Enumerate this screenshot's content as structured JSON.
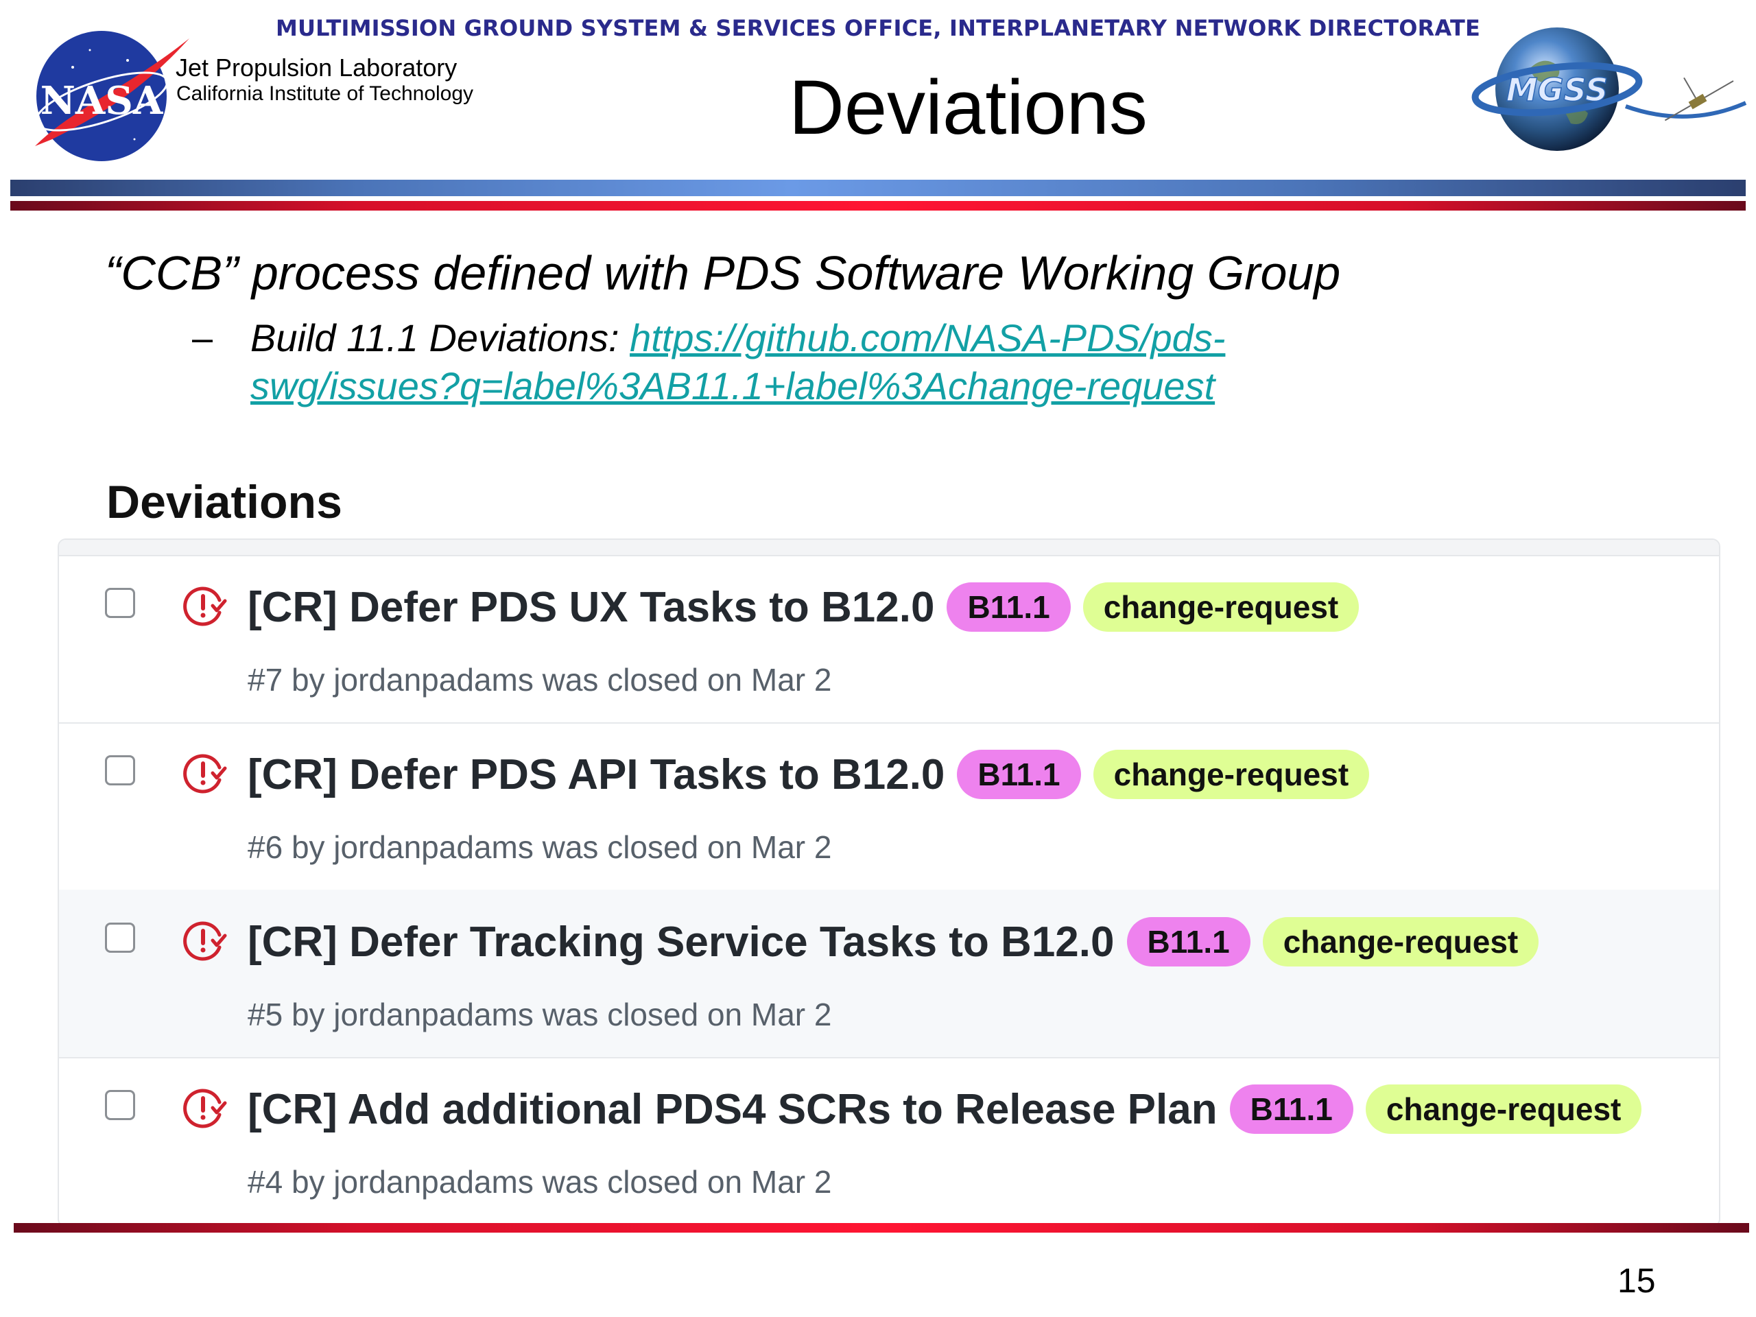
{
  "header": {
    "directorate": "MULTIMISSION GROUND SYSTEM & SERVICES OFFICE, INTERPLANETARY NETWORK DIRECTORATE",
    "jpl_line1": "Jet Propulsion Laboratory",
    "jpl_line2": "California Institute of Technology",
    "title": "Deviations",
    "nasa_logo_text": "NASA",
    "mgss_logo_text": "MGSS"
  },
  "body": {
    "ccb_line": "“CCB” process defined with PDS Software Working Group",
    "bullet_dash": "–",
    "build_label": "Build 11.1 Deviations: ",
    "build_url": "https://github.com/NASA-PDS/pds-swg/issues?q=label%3AB11.1+label%3Achange-request"
  },
  "panel": {
    "heading": "Deviations",
    "issues": [
      {
        "title": "[CR] Defer PDS UX Tasks to B12.0",
        "label1": "B11.1",
        "label2": "change-request",
        "meta": "#7 by jordanpadams was closed on Mar 2"
      },
      {
        "title": "[CR] Defer PDS API Tasks to B12.0",
        "label1": "B11.1",
        "label2": "change-request",
        "meta": "#6 by jordanpadams was closed on Mar 2"
      },
      {
        "title": "[CR] Defer Tracking Service Tasks to B12.0",
        "label1": "B11.1",
        "label2": "change-request",
        "meta": "#5 by jordanpadams was closed on Mar 2"
      },
      {
        "title": "[CR] Add additional PDS4 SCRs to Release Plan",
        "label1": "B11.1",
        "label2": "change-request",
        "meta": "#4 by jordanpadams was closed on Mar 2"
      }
    ]
  },
  "footer": {
    "page_number": "15"
  },
  "colors": {
    "link": "#12a0a5",
    "label_b111": "#ee82ee",
    "label_change_request": "#dffe94",
    "closed_icon": "#cf222e",
    "icons": [
      "issue-closed-icon",
      "checkbox-icon"
    ]
  }
}
